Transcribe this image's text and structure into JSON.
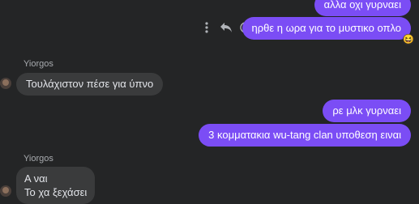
{
  "messages": {
    "out1": "αλλα οχι γυρναει",
    "out2": "ηρθε η ωρα για το μυστικο οπλο",
    "reaction_emoji": "😆",
    "in_sender1": "Yiorgos",
    "in1": "Τουλάχιστον πέσε για ύπνο",
    "out3": "ρε μλκ γυρναει",
    "out4": "3 κομματακια wu-tang clan υποθεση ειναι",
    "in_sender2": "Yiorgos",
    "in2_line1": "Α ναι",
    "in2_line2": "Το χα ξεχάσει"
  },
  "icons": {
    "more": "more-vertical-icon",
    "reply": "reply-icon",
    "react": "smiley-icon"
  },
  "colors": {
    "background": "#242526",
    "outgoing_bubble": "#7b4df5",
    "incoming_bubble": "#3a3b3c"
  }
}
